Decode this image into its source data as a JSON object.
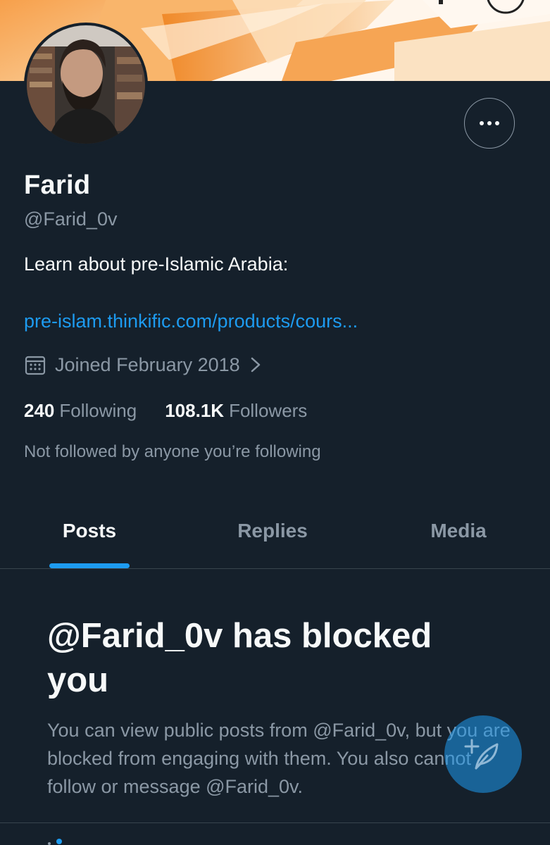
{
  "profile": {
    "name": "Farid",
    "handle": "@Farid_0v",
    "bio": "Learn about pre-Islamic Arabia:",
    "link": "pre-islam.thinkific.com/products/cours...",
    "joined": "Joined February 2018",
    "following_count": "240",
    "following_label": "Following",
    "followers_count": "108.1K",
    "followers_label": "Followers",
    "mutual_note": "Not followed by anyone you’re following"
  },
  "tabs": [
    {
      "label": "Posts",
      "active": true
    },
    {
      "label": "Replies",
      "active": false
    },
    {
      "label": "Media",
      "active": false
    }
  ],
  "blocked": {
    "title": "@Farid_0v has blocked you",
    "description": "You can view public posts from @Farid_0v, but you are blocked from engaging with them. You also cannot follow or message @Farid_0v."
  },
  "colors": {
    "background": "#15202b",
    "accent": "#1d9bf0",
    "primary_text": "#f7f9f9",
    "secondary_text": "#8b98a5",
    "divider": "#38444d"
  },
  "icons": {
    "more": "more-horizontal-icon",
    "calendar": "calendar-icon",
    "chevron": "chevron-right-icon",
    "compose": "compose-post-icon"
  }
}
